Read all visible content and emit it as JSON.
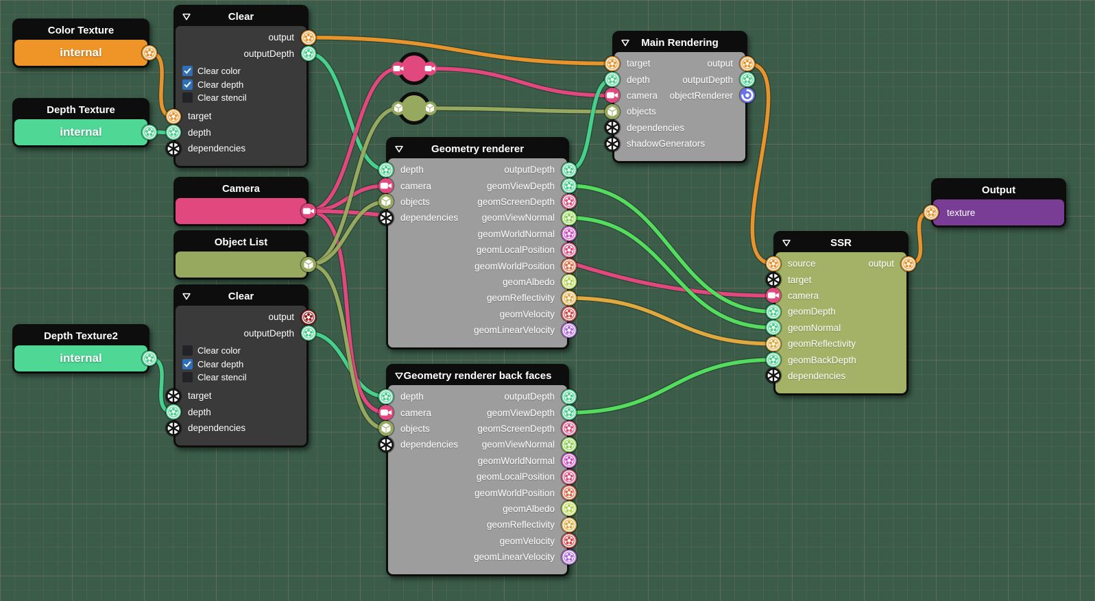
{
  "colors": {
    "orange": "#e8942d",
    "mint": "#47cf8c",
    "brightgreen": "#54dc5e",
    "lightgreen": "#8ad14e",
    "lime": "#b2d44b",
    "pink": "#e0487e",
    "pinkred": "#db4f7d",
    "magenta": "#cf4ec4",
    "salmon": "#dd6a49",
    "amber": "#dfa93f",
    "red": "#d24a4a",
    "violet": "#b166dd",
    "olive": "#97a85f",
    "blue": "#6a72e8",
    "portblack": "#141414",
    "darkred": "#8e1c1c",
    "checkblue": "#2e6fb7",
    "bodygray": "#9d9d9d",
    "bodydark": "#3a3a3a",
    "ssrbody": "#a3b266",
    "ctbody": "#ef9528",
    "dtbody": "#4fd795",
    "cambody": "#e0487e",
    "objbody": "#97a85f",
    "outbody": "#7a3d95"
  },
  "nodes": {
    "colorTexture": {
      "title": "Color Texture",
      "value": "internal"
    },
    "depthTexture": {
      "title": "Depth Texture",
      "value": "internal"
    },
    "depthTexture2": {
      "title": "Depth Texture2",
      "value": "internal"
    },
    "camera": {
      "title": "Camera"
    },
    "objectList": {
      "title": "Object List"
    },
    "clear1": {
      "title": "Clear",
      "outputs": [
        "output",
        "outputDepth"
      ],
      "options": [
        {
          "label": "Clear color",
          "checked": true
        },
        {
          "label": "Clear depth",
          "checked": true
        },
        {
          "label": "Clear stencil",
          "checked": false
        }
      ],
      "inputs": [
        "target",
        "depth",
        "dependencies"
      ]
    },
    "clear2": {
      "title": "Clear",
      "outputs": [
        "output",
        "outputDepth"
      ],
      "options": [
        {
          "label": "Clear color",
          "checked": false
        },
        {
          "label": "Clear depth",
          "checked": true
        },
        {
          "label": "Clear stencil",
          "checked": false
        }
      ],
      "inputs": [
        "target",
        "depth",
        "dependencies"
      ]
    },
    "geom": {
      "title": "Geometry renderer",
      "inputs": [
        "depth",
        "camera",
        "objects",
        "dependencies"
      ],
      "outputs": [
        "outputDepth",
        "geomViewDepth",
        "geomScreenDepth",
        "geomViewNormal",
        "geomWorldNormal",
        "geomLocalPosition",
        "geomWorldPosition",
        "geomAlbedo",
        "geomReflectivity",
        "geomVelocity",
        "geomLinearVelocity"
      ]
    },
    "backfaces": {
      "title": "Geometry renderer back faces",
      "inputs": [
        "depth",
        "camera",
        "objects",
        "dependencies"
      ],
      "outputs": [
        "outputDepth",
        "geomViewDepth",
        "geomScreenDepth",
        "geomViewNormal",
        "geomWorldNormal",
        "geomLocalPosition",
        "geomWorldPosition",
        "geomAlbedo",
        "geomReflectivity",
        "geomVelocity",
        "geomLinearVelocity"
      ]
    },
    "main": {
      "title": "Main Rendering",
      "inputs": [
        "target",
        "depth",
        "camera",
        "objects",
        "dependencies",
        "shadowGenerators"
      ],
      "outputs": [
        "output",
        "outputDepth",
        "objectRenderer"
      ]
    },
    "ssr": {
      "title": "SSR",
      "inputs": [
        "source",
        "target",
        "camera",
        "geomDepth",
        "geomNormal",
        "geomReflectivity",
        "geomBackDepth",
        "dependencies"
      ],
      "outputs": [
        "output"
      ]
    },
    "output": {
      "title": "Output",
      "inputs": [
        "texture"
      ]
    }
  },
  "connections": [
    {
      "from": "colorTexture.internal",
      "to": "clear1.target",
      "color": "orange"
    },
    {
      "from": "depthTexture.internal",
      "to": "clear1.depth",
      "color": "mint"
    },
    {
      "from": "depthTexture2.internal",
      "to": "clear2.depth",
      "color": "mint"
    },
    {
      "from": "clear1.output",
      "to": "main.target",
      "color": "orange"
    },
    {
      "from": "clear1.outputDepth",
      "to": "geom.depth",
      "color": "mint"
    },
    {
      "from": "clear2.outputDepth",
      "to": "backfaces.depth",
      "color": "mint"
    },
    {
      "from": "camera.output",
      "to": "elbowCam.in",
      "color": "pink"
    },
    {
      "from": "elbowCam.out",
      "to": "main.camera",
      "color": "pink"
    },
    {
      "from": "camera.output",
      "to": "geom.camera",
      "color": "pink"
    },
    {
      "from": "camera.output",
      "to": "backfaces.camera",
      "color": "pink"
    },
    {
      "from": "camera.output",
      "to": "ssr.camera",
      "color": "pink"
    },
    {
      "from": "objectList.output",
      "to": "elbowObj.in",
      "color": "olive"
    },
    {
      "from": "elbowObj.out",
      "to": "main.objects",
      "color": "olive"
    },
    {
      "from": "objectList.output",
      "to": "geom.objects",
      "color": "olive"
    },
    {
      "from": "objectList.output",
      "to": "backfaces.objects",
      "color": "olive"
    },
    {
      "from": "geom.outputDepth",
      "to": "main.depth",
      "color": "mint"
    },
    {
      "from": "geom.geomViewDepth",
      "to": "ssr.geomDepth",
      "color": "brightgreen"
    },
    {
      "from": "geom.geomViewNormal",
      "to": "ssr.geomNormal",
      "color": "brightgreen"
    },
    {
      "from": "geom.geomReflectivity",
      "to": "ssr.geomReflectivity",
      "color": "amber"
    },
    {
      "from": "backfaces.geomViewDepth",
      "to": "ssr.geomBackDepth",
      "color": "brightgreen"
    },
    {
      "from": "main.output",
      "to": "ssr.source",
      "color": "orange"
    },
    {
      "from": "ssr.output",
      "to": "output.texture",
      "color": "orange"
    }
  ]
}
